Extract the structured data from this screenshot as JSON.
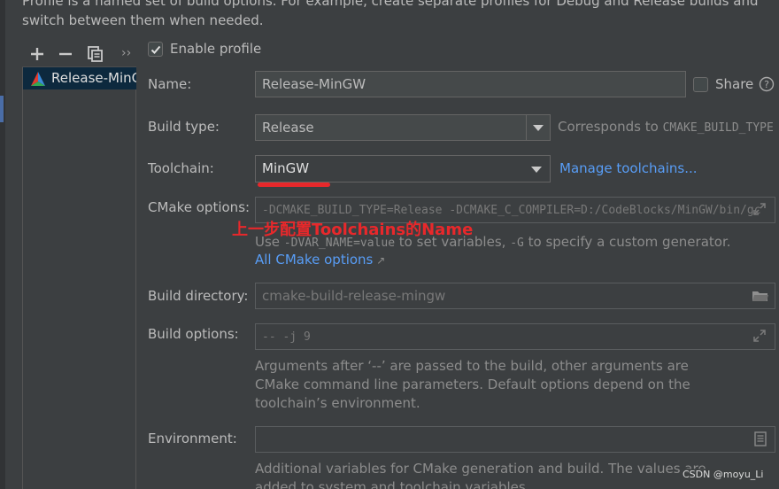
{
  "intro": {
    "line1": "Profile is a named set of build options. For example, create separate profiles for Debug and Release builds and",
    "line2": "switch between them when needed."
  },
  "profiles_toolbar": {
    "add_icon": "plus-icon",
    "remove_icon": "minus-icon",
    "copy_icon": "copy-icon",
    "more": "››"
  },
  "profiles": [
    {
      "label": "Release-MinGW",
      "icon": "cmake-icon",
      "selected": true
    }
  ],
  "enable_profile": {
    "label": "Enable profile",
    "checked": true
  },
  "form": {
    "name": {
      "label": "Name:",
      "value": "Release-MinGW"
    },
    "share": {
      "label": "Share",
      "checked": false,
      "help_icon": "help-icon"
    },
    "build_type": {
      "label": "Build type:",
      "value": "Release",
      "hint_prefix": "Corresponds to ",
      "hint_code": "CMAKE_BUILD_TYPE"
    },
    "toolchain": {
      "label": "Toolchain:",
      "value": "MinGW",
      "manage_link": "Manage toolchains..."
    },
    "cmake_options": {
      "label": "CMake options:",
      "value": "-DCMAKE_BUILD_TYPE=Release -DCMAKE_C_COMPILER=D:/CodeBlocks/MinGW/bin/gc",
      "hint_use": "Use ",
      "hint_code1": "-DVAR_NAME=value",
      "hint_mid": " to set variables, ",
      "hint_code2": "-G",
      "hint_end": " to specify a custom generator.",
      "all_options_link": "All CMake options",
      "expand_icon": "expand-icon"
    },
    "build_directory": {
      "label": "Build directory:",
      "value": "cmake-build-release-mingw",
      "folder_icon": "folder-icon"
    },
    "build_options": {
      "label": "Build options:",
      "placeholder": "-- -j 9",
      "expand_icon": "expand-icon",
      "hint_line1": "Arguments after ‘--’ are passed to the build, other arguments are",
      "hint_line2": "CMake command line parameters. Default options depend on the",
      "hint_line3": "toolchain’s environment."
    },
    "environment": {
      "label": "Environment:",
      "value": "",
      "doc_icon": "document-icon",
      "hint_line1": "Additional variables for CMake generation and build. The values are",
      "hint_line2": "added to system and toolchain variables."
    }
  },
  "annotation": {
    "text": "上一步配置Toolchains的Name",
    "color": "#e8282b"
  },
  "watermark": "CSDN @moyu_Li",
  "colors": {
    "background": "#3c3f41",
    "field": "#45494a",
    "link": "#589df6",
    "selection": "#0d293e",
    "annotation": "#e8282b"
  }
}
